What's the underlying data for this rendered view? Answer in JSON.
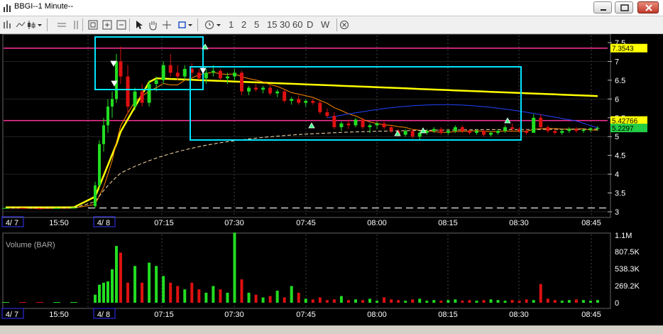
{
  "window": {
    "title": "BBGI--1 Minute--"
  },
  "toolbar": {
    "timeframes": [
      "1",
      "2",
      "5",
      "15",
      "30",
      "60",
      "D",
      "W"
    ]
  },
  "chart_data": [
    {
      "type": "candlestick",
      "title": "",
      "price_axis": {
        "ticks": [
          "7.5",
          "7",
          "6.5",
          "6",
          "5.5",
          "5",
          "4.5",
          "4",
          "3.5",
          "3"
        ],
        "ylim": [
          3,
          7.6
        ]
      },
      "time_axis": {
        "ticks": [
          "4/ 7",
          "15:50",
          "4/ 8",
          "07:15",
          "07:30",
          "07:45",
          "08:00",
          "08:15",
          "08:30",
          "08:45"
        ]
      },
      "price_labels": [
        {
          "label": "7.3543",
          "color": "#ffff00"
        },
        {
          "label": "5.42766",
          "color": "#ffff00"
        },
        {
          "label": "5.2297",
          "color": "#22cc44"
        }
      ],
      "horizontal_lines": [
        {
          "name": "resistance",
          "value": 7.3543,
          "color": "#ff3399"
        },
        {
          "name": "support",
          "value": 5.42766,
          "color": "#ff3399"
        },
        {
          "name": "prior-close",
          "value": 3.1,
          "color": "#ffffff",
          "style": "dashed"
        }
      ],
      "series": [
        {
          "kind": "candles",
          "candles": [
            [
              3.1,
              3.12,
              3.08,
              3.1
            ],
            [
              3.1,
              3.11,
              3.08,
              3.09
            ],
            [
              3.09,
              3.1,
              3.07,
              3.08
            ],
            [
              3.1,
              3.11,
              3.08,
              3.1
            ],
            [
              3.1,
              3.12,
              3.09,
              3.11
            ],
            [
              3.15,
              3.8,
              3.1,
              3.7
            ],
            [
              3.7,
              4.9,
              3.6,
              4.8
            ],
            [
              4.8,
              5.5,
              4.6,
              5.3
            ],
            [
              5.3,
              6.0,
              5.1,
              5.8
            ],
            [
              5.8,
              6.2,
              5.5,
              6.0
            ],
            [
              6.0,
              7.2,
              5.9,
              7.0
            ],
            [
              7.0,
              7.4,
              6.4,
              6.6
            ],
            [
              6.6,
              6.9,
              5.6,
              5.8
            ],
            [
              5.8,
              6.3,
              5.7,
              6.2
            ],
            [
              6.2,
              6.4,
              5.8,
              5.9
            ],
            [
              5.9,
              6.5,
              5.8,
              6.4
            ],
            [
              6.4,
              6.6,
              6.2,
              6.5
            ],
            [
              6.5,
              7.0,
              6.4,
              6.9
            ],
            [
              6.9,
              7.2,
              6.6,
              6.7
            ],
            [
              6.7,
              6.9,
              6.5,
              6.6
            ],
            [
              6.6,
              6.9,
              6.5,
              6.8
            ],
            [
              6.8,
              6.95,
              6.6,
              6.7
            ],
            [
              6.7,
              6.8,
              6.5,
              6.55
            ],
            [
              6.55,
              6.8,
              6.4,
              6.7
            ],
            [
              6.7,
              6.9,
              6.6,
              6.75
            ],
            [
              6.75,
              6.8,
              6.5,
              6.55
            ],
            [
              6.55,
              6.7,
              6.4,
              6.6
            ],
            [
              6.6,
              6.8,
              6.5,
              6.7
            ],
            [
              6.7,
              6.75,
              6.1,
              6.2
            ],
            [
              6.2,
              6.35,
              6.1,
              6.3
            ],
            [
              6.3,
              6.4,
              6.2,
              6.25
            ],
            [
              6.25,
              6.35,
              6.15,
              6.3
            ],
            [
              6.3,
              6.35,
              6.1,
              6.15
            ],
            [
              6.15,
              6.25,
              6.05,
              6.2
            ],
            [
              6.2,
              6.25,
              5.9,
              5.95
            ],
            [
              5.95,
              6.05,
              5.85,
              6.0
            ],
            [
              6.0,
              6.1,
              5.85,
              5.9
            ],
            [
              5.9,
              6.0,
              5.8,
              5.95
            ],
            [
              5.95,
              6.0,
              5.85,
              5.9
            ],
            [
              5.9,
              5.95,
              5.6,
              5.65
            ],
            [
              5.65,
              5.75,
              5.5,
              5.55
            ],
            [
              5.55,
              5.65,
              5.2,
              5.25
            ],
            [
              5.25,
              5.4,
              5.15,
              5.35
            ],
            [
              5.35,
              5.45,
              5.2,
              5.3
            ],
            [
              5.3,
              5.5,
              5.25,
              5.45
            ],
            [
              5.45,
              5.5,
              5.2,
              5.25
            ],
            [
              5.25,
              5.35,
              5.1,
              5.3
            ],
            [
              5.3,
              5.4,
              5.2,
              5.35
            ],
            [
              5.35,
              5.4,
              5.2,
              5.25
            ],
            [
              5.25,
              5.3,
              5.1,
              5.15
            ],
            [
              5.15,
              5.2,
              5.0,
              5.05
            ],
            [
              5.05,
              5.2,
              5.0,
              5.15
            ],
            [
              5.15,
              5.2,
              4.95,
              5.0
            ],
            [
              5.0,
              5.15,
              4.9,
              5.1
            ],
            [
              5.1,
              5.2,
              5.05,
              5.15
            ],
            [
              5.15,
              5.25,
              5.1,
              5.2
            ],
            [
              5.2,
              5.25,
              5.05,
              5.1
            ],
            [
              5.1,
              5.2,
              5.05,
              5.15
            ],
            [
              5.15,
              5.3,
              5.1,
              5.25
            ],
            [
              5.25,
              5.3,
              5.1,
              5.15
            ],
            [
              5.15,
              5.2,
              5.05,
              5.1
            ],
            [
              5.1,
              5.2,
              5.05,
              5.15
            ],
            [
              5.15,
              5.2,
              5.0,
              5.05
            ],
            [
              5.05,
              5.15,
              5.0,
              5.1
            ],
            [
              5.1,
              5.2,
              5.05,
              5.15
            ],
            [
              5.15,
              5.3,
              5.1,
              5.25
            ],
            [
              5.25,
              5.35,
              5.15,
              5.2
            ],
            [
              5.2,
              5.25,
              5.1,
              5.15
            ],
            [
              5.15,
              5.2,
              5.05,
              5.1
            ],
            [
              5.1,
              5.6,
              5.1,
              5.5
            ],
            [
              5.5,
              5.6,
              5.2,
              5.25
            ],
            [
              5.25,
              5.3,
              5.1,
              5.15
            ],
            [
              5.15,
              5.2,
              5.05,
              5.1
            ],
            [
              5.1,
              5.2,
              5.05,
              5.15
            ],
            [
              5.15,
              5.25,
              5.1,
              5.2
            ],
            [
              5.2,
              5.25,
              5.1,
              5.15
            ],
            [
              5.15,
              5.2,
              5.1,
              5.18
            ],
            [
              5.18,
              5.25,
              5.12,
              5.22
            ],
            [
              5.22,
              5.28,
              5.15,
              5.23
            ]
          ]
        }
      ]
    },
    {
      "type": "bar",
      "title": "Volume (BAR)",
      "y_ticks": [
        "1.1M",
        "807.5K",
        "538.3K",
        "269.2K",
        "0"
      ],
      "ylim": [
        0,
        1100000
      ]
    }
  ]
}
